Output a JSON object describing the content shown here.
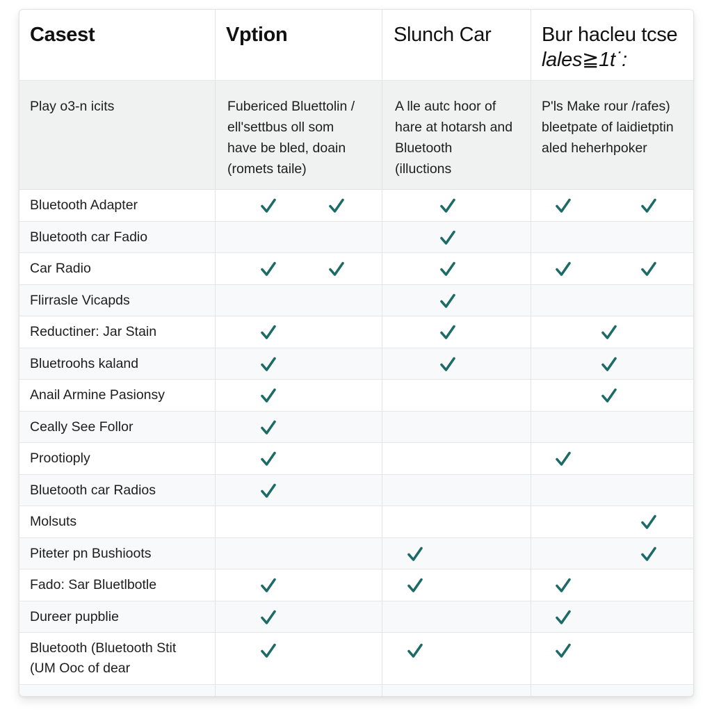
{
  "colors": {
    "accent_check": "#1c6b66",
    "header_bg": "#ffffff",
    "subheader_bg": "#f0f1f1",
    "row_alt_bg": "#f8f9fa",
    "grid_line": "#e4e4e4"
  },
  "table": {
    "headers": [
      {
        "label": "Casest",
        "bold": true
      },
      {
        "label": "Vption",
        "bold": true
      },
      {
        "label": "Slunch Car",
        "bold": false
      },
      {
        "label_line1": "Bur hacleu tcse",
        "label_line2": "lales≧1t˙:",
        "bold": false
      }
    ],
    "subheaders": [
      [
        "Play o3-n icits"
      ],
      [
        "Fubericed Bluettolin /",
        "ell'settbus oll som",
        "have be bled, doain",
        "(romets taile)"
      ],
      [
        "A lle autc hoor of",
        "hare at hotarsh and",
        "Bluetooth",
        "(illuctions"
      ],
      [
        "P'ls Make rour /rafes)",
        "bleetpate of laidietptin",
        "aled heherhpoker"
      ]
    ],
    "check_icon": "checkmark-icon",
    "rows": [
      {
        "label": [
          "Bluetooth Adapter"
        ],
        "checks": {
          "vption_a": true,
          "vption_b": true,
          "slunch_a": false,
          "slunch_mid": true,
          "bur_a": true,
          "bur_mid": false,
          "bur_b": true
        }
      },
      {
        "label": [
          "Bluetooth car Fadio"
        ],
        "checks": {
          "vption_a": false,
          "vption_b": false,
          "slunch_a": false,
          "slunch_mid": true,
          "bur_a": false,
          "bur_mid": false,
          "bur_b": false
        }
      },
      {
        "label": [
          "Car Radio"
        ],
        "checks": {
          "vption_a": true,
          "vption_b": true,
          "slunch_a": false,
          "slunch_mid": true,
          "bur_a": true,
          "bur_mid": false,
          "bur_b": true
        }
      },
      {
        "label": [
          "Flirrasle Vicapds"
        ],
        "checks": {
          "vption_a": false,
          "vption_b": false,
          "slunch_a": false,
          "slunch_mid": true,
          "bur_a": false,
          "bur_mid": false,
          "bur_b": false
        }
      },
      {
        "label": [
          "Reductiner: Jar Stain"
        ],
        "checks": {
          "vption_a": true,
          "vption_b": false,
          "slunch_a": false,
          "slunch_mid": true,
          "bur_a": false,
          "bur_mid": true,
          "bur_b": false
        }
      },
      {
        "label": [
          "Bluetroohs kaland"
        ],
        "checks": {
          "vption_a": true,
          "vption_b": false,
          "slunch_a": false,
          "slunch_mid": true,
          "bur_a": false,
          "bur_mid": true,
          "bur_b": false
        }
      },
      {
        "label": [
          "Anail Armine Pasionsy"
        ],
        "checks": {
          "vption_a": true,
          "vption_b": false,
          "slunch_a": false,
          "slunch_mid": false,
          "bur_a": false,
          "bur_mid": true,
          "bur_b": false
        }
      },
      {
        "label": [
          "Ceally See Follor"
        ],
        "checks": {
          "vption_a": true,
          "vption_b": false,
          "slunch_a": false,
          "slunch_mid": false,
          "bur_a": false,
          "bur_mid": false,
          "bur_b": false
        }
      },
      {
        "label": [
          "Prootioply"
        ],
        "checks": {
          "vption_a": true,
          "vption_b": false,
          "slunch_a": false,
          "slunch_mid": false,
          "bur_a": true,
          "bur_mid": false,
          "bur_b": false
        }
      },
      {
        "label": [
          "Bluetooth car Radios"
        ],
        "checks": {
          "vption_a": true,
          "vption_b": false,
          "slunch_a": false,
          "slunch_mid": false,
          "bur_a": false,
          "bur_mid": false,
          "bur_b": false
        }
      },
      {
        "label": [
          "Molsuts"
        ],
        "checks": {
          "vption_a": false,
          "vption_b": false,
          "slunch_a": false,
          "slunch_mid": false,
          "bur_a": false,
          "bur_mid": false,
          "bur_b": true
        }
      },
      {
        "label": [
          "Piteter pn Bushioots"
        ],
        "checks": {
          "vption_a": false,
          "vption_b": false,
          "slunch_a": true,
          "slunch_mid": false,
          "bur_a": false,
          "bur_mid": false,
          "bur_b": true
        }
      },
      {
        "label": [
          "Fado: Sar Bluetlbotle"
        ],
        "checks": {
          "vption_a": true,
          "vption_b": false,
          "slunch_a": true,
          "slunch_mid": false,
          "bur_a": true,
          "bur_mid": false,
          "bur_b": false
        }
      },
      {
        "label": [
          "Dureer pupblie"
        ],
        "checks": {
          "vption_a": true,
          "vption_b": false,
          "slunch_a": false,
          "slunch_mid": false,
          "bur_a": true,
          "bur_mid": false,
          "bur_b": false
        }
      },
      {
        "label": [
          "Bluetooth (Bluetooth Stit",
          "(UM Ooc of dear"
        ],
        "checks": {
          "vption_a": true,
          "vption_b": false,
          "slunch_a": true,
          "slunch_mid": false,
          "bur_a": true,
          "bur_mid": false,
          "bur_b": false
        }
      }
    ]
  }
}
